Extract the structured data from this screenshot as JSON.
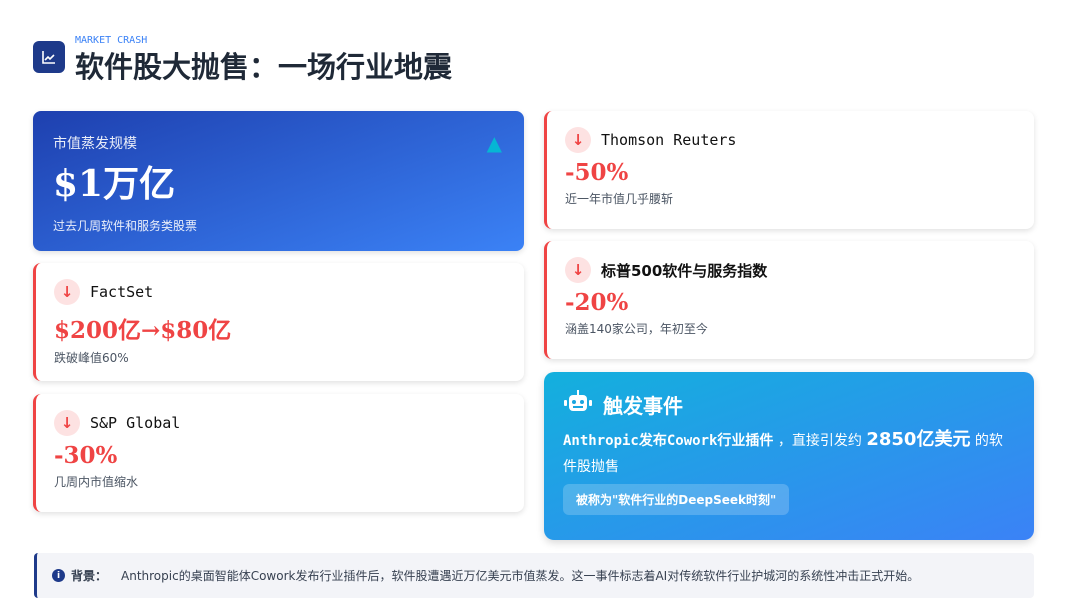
{
  "header": {
    "kicker": "MARKET CRASH",
    "title": "软件股大抛售：一场行业地震"
  },
  "hero": {
    "label": "市值蒸发规模",
    "value": "$1万亿",
    "sub": "过去几周软件和服务类股票"
  },
  "cards": [
    {
      "name": "FactSet",
      "value": "$200亿→$80亿",
      "desc": "跌破峰值60%"
    },
    {
      "name": "S&P Global",
      "value": "-30%",
      "desc": "几周内市值缩水"
    },
    {
      "name": "Thomson Reuters",
      "value": "-50%",
      "desc": "近一年市值几乎腰斩"
    },
    {
      "name": "标普500软件与服务指数",
      "value": "-20%",
      "desc": "涵盖140家公司，年初至今"
    }
  ],
  "trigger": {
    "title": "触发事件",
    "p1": "Anthropic发布Cowork行业插件",
    "p2": "，直接引发约",
    "amount": "2850亿美元",
    "p3": "的软件股抛售",
    "pill": "被称为\"软件行业的DeepSeek时刻\""
  },
  "note": {
    "label": "背景：",
    "text": "Anthropic的桌面智能体Cowork发布行业插件后，软件股遭遇近万亿美元市值蒸发。这一事件标志着AI对传统软件行业护城河的系统性冲击正式开始。"
  }
}
